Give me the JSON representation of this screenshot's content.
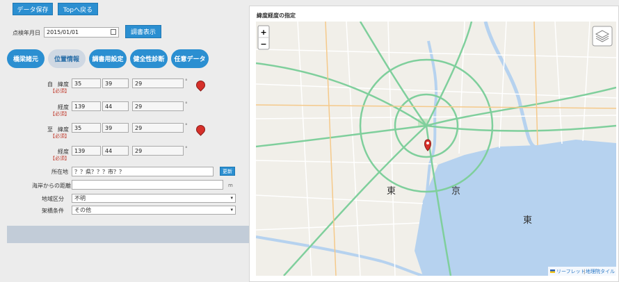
{
  "toolbar": {
    "save_label": "データ保存",
    "top_label": "Topへ戻る"
  },
  "inspection": {
    "date_label": "点検年月日",
    "date_value": "2015/01/01",
    "report_label": "調書表示"
  },
  "tabs": [
    {
      "label": "橋梁諸元",
      "active": false
    },
    {
      "label": "位置情報",
      "active": true
    },
    {
      "label": "調書用設定",
      "active": false
    },
    {
      "label": "健全性診断",
      "active": false
    },
    {
      "label": "任意データ",
      "active": false
    }
  ],
  "position": {
    "from_label": "自",
    "to_label": "至",
    "lat_label": "緯度",
    "lon_label": "経度",
    "required": "【必須】",
    "deg_mark": "°",
    "from_lat": [
      "35",
      "39",
      "29"
    ],
    "from_lon": [
      "139",
      "44",
      "29"
    ],
    "to_lat": [
      "35",
      "39",
      "29"
    ],
    "to_lon": [
      "139",
      "44",
      "29"
    ]
  },
  "address": {
    "label": "所在地",
    "value": "？？県？？？市？？",
    "update_label": "更新"
  },
  "coast": {
    "label": "海岸からの距離",
    "value": "",
    "unit": "m"
  },
  "region": {
    "label": "地域区分",
    "value": "不明"
  },
  "bridge": {
    "label": "架橋条件",
    "value": "その他"
  },
  "map": {
    "title": "緯度経度の指定",
    "zoom_in": "+",
    "zoom_out": "−",
    "kanji_tokyo": "東",
    "kanji_kyo": "京",
    "attribution_leaflet": "リーフレット",
    "attribution_sep": "|",
    "attribution_tile": "地理院タイル",
    "colors": {
      "water": "#b6d2ef",
      "land": "#f1efe9",
      "road_major": "#7fcf9c",
      "road_minor": "#ffffff"
    }
  }
}
